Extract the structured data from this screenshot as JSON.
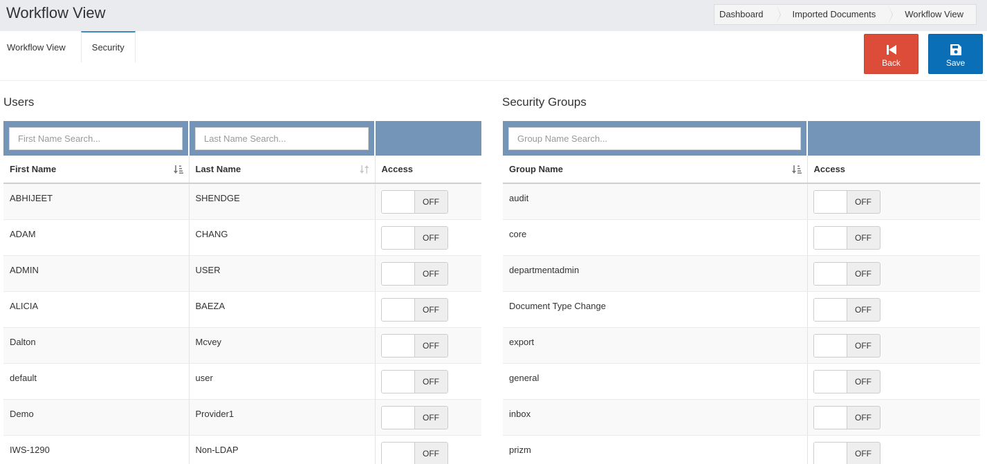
{
  "header": {
    "title": "Workflow View",
    "breadcrumb": [
      "Dashboard",
      "Imported Documents",
      "Workflow View"
    ]
  },
  "tabs": [
    {
      "label": "Workflow View",
      "active": false
    },
    {
      "label": "Security",
      "active": true
    }
  ],
  "actions": {
    "back_label": "Back",
    "save_label": "Save"
  },
  "colors": {
    "back": "#dd4b39",
    "save": "#0b6fb8",
    "filter_bar": "#7495b7",
    "tab_accent": "#3c8dbc"
  },
  "users": {
    "title": "Users",
    "first_name_placeholder": "First Name Search...",
    "last_name_placeholder": "Last Name Search...",
    "columns": [
      "First Name",
      "Last Name",
      "Access"
    ],
    "rows": [
      {
        "first": "ABHIJEET",
        "last": "SHENDGE",
        "access": "OFF"
      },
      {
        "first": "ADAM",
        "last": "CHANG",
        "access": "OFF"
      },
      {
        "first": "ADMIN",
        "last": "USER",
        "access": "OFF"
      },
      {
        "first": "ALICIA",
        "last": "BAEZA",
        "access": "OFF"
      },
      {
        "first": "Dalton",
        "last": "Mcvey",
        "access": "OFF"
      },
      {
        "first": "default",
        "last": "user",
        "access": "OFF"
      },
      {
        "first": "Demo",
        "last": "Provider1",
        "access": "OFF"
      },
      {
        "first": "IWS-1290",
        "last": "Non-LDAP",
        "access": "OFF"
      }
    ]
  },
  "groups": {
    "title": "Security Groups",
    "group_name_placeholder": "Group Name Search...",
    "columns": [
      "Group Name",
      "Access"
    ],
    "rows": [
      {
        "name": "audit",
        "access": "OFF"
      },
      {
        "name": "core",
        "access": "OFF"
      },
      {
        "name": "departmentadmin",
        "access": "OFF"
      },
      {
        "name": "Document Type Change",
        "access": "OFF"
      },
      {
        "name": "export",
        "access": "OFF"
      },
      {
        "name": "general",
        "access": "OFF"
      },
      {
        "name": "inbox",
        "access": "OFF"
      },
      {
        "name": "prizm",
        "access": "OFF"
      }
    ]
  }
}
